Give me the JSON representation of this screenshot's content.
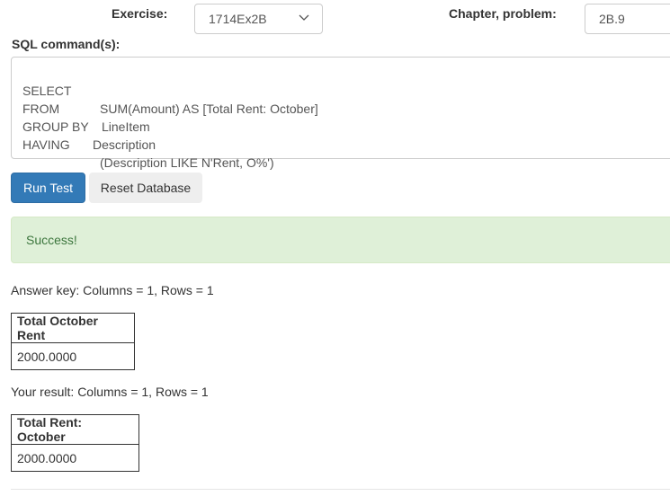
{
  "exercise": {
    "label": "Exercise:",
    "value": "1714Ex2B"
  },
  "chapter": {
    "label": "Chapter, problem:",
    "value": "2B.9"
  },
  "sql": {
    "label": "SQL command(s):",
    "lines": [
      {
        "kw": "SELECT",
        "arg": "SUM(Amount) AS [Total Rent: October]"
      },
      {
        "kw": "FROM",
        "arg": "LineItem"
      },
      {
        "kw": "GROUP BY",
        "arg": "Description"
      },
      {
        "kw": "HAVING",
        "arg": "(Description LIKE N'Rent, O%')"
      }
    ]
  },
  "buttons": {
    "run": "Run Test",
    "reset": "Reset Database"
  },
  "alert": {
    "text": "Success!"
  },
  "answer_key": {
    "summary": "Answer key: Columns = 1, Rows = 1",
    "header": "Total October Rent",
    "rows": [
      "2000.0000"
    ]
  },
  "your_result": {
    "summary": "Your result: Columns = 1, Rows = 1",
    "header": "Total Rent: October",
    "rows": [
      "2000.0000"
    ]
  },
  "colors": {
    "primary": "#337ab7",
    "success_bg": "#dff0d8",
    "success_text": "#3c763d"
  }
}
